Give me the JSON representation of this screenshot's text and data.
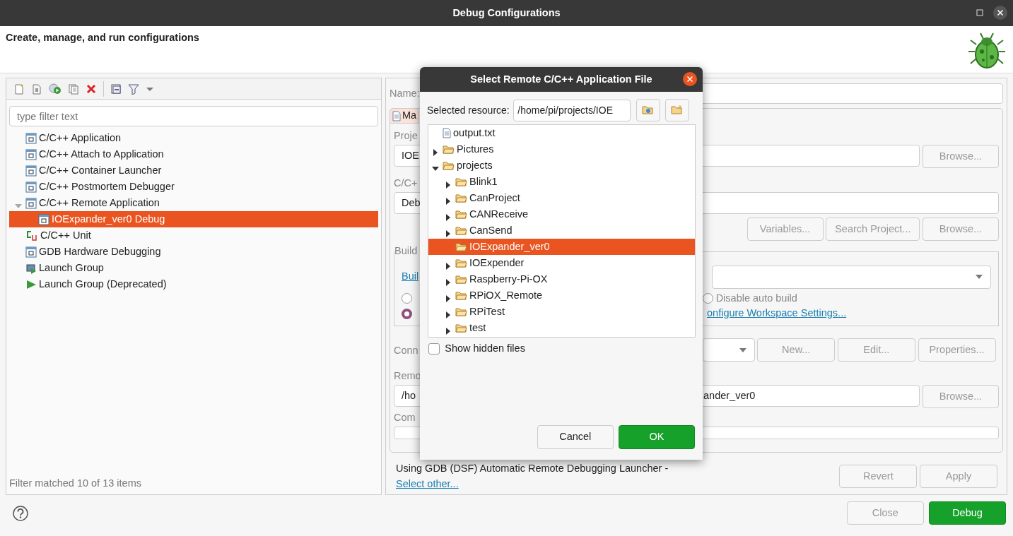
{
  "window": {
    "title": "Debug Configurations"
  },
  "header": {
    "title": "Create, manage, and run configurations"
  },
  "left_panel": {
    "filter": {
      "placeholder": "type filter text"
    },
    "tree": [
      {
        "label": "C/C++ Application",
        "kind": "config",
        "selected": false
      },
      {
        "label": "C/C++ Attach to Application",
        "kind": "config",
        "selected": false
      },
      {
        "label": "C/C++ Container Launcher",
        "kind": "config",
        "selected": false
      },
      {
        "label": "C/C++ Postmortem Debugger",
        "kind": "config",
        "selected": false
      },
      {
        "label": "C/C++ Remote Application",
        "kind": "config",
        "selected": false,
        "expanded": true,
        "children": [
          {
            "label": "IOExpander_ver0 Debug",
            "kind": "config",
            "selected": true
          }
        ]
      },
      {
        "label": "C/C++ Unit",
        "kind": "unit",
        "selected": false
      },
      {
        "label": "GDB Hardware Debugging",
        "kind": "config",
        "selected": false
      },
      {
        "label": "Launch Group",
        "kind": "group",
        "selected": false
      },
      {
        "label": "Launch Group (Deprecated)",
        "kind": "play",
        "selected": false
      }
    ],
    "status": "Filter matched 10 of 13 items"
  },
  "right_panel": {
    "name_label": "Name:",
    "tab": {
      "label": "Ma",
      "selected": true
    },
    "project": {
      "label": "Proje",
      "value": "IOE",
      "button": {
        "label": "Browse...",
        "disabled": true
      }
    },
    "application": {
      "label": "C/C+",
      "value": "Deb"
    },
    "app_buttons": [
      {
        "label": "Variables...",
        "disabled": true
      },
      {
        "label": "Search Project...",
        "disabled": true
      },
      {
        "label": "Browse...",
        "disabled": true
      }
    ],
    "build": {
      "legend": "Build",
      "link": "Buil",
      "radios": [
        {
          "checked": false
        },
        {
          "label": "Disable auto build",
          "checked": false
        },
        {
          "checked": true
        }
      ],
      "settings_link": "onfigure Workspace Settings..."
    },
    "connection": {
      "label": "Conn",
      "buttons": [
        {
          "label": "New...",
          "disabled": true
        },
        {
          "label": "Edit...",
          "disabled": true
        },
        {
          "label": "Properties...",
          "disabled": true
        }
      ]
    },
    "remote": {
      "label": "Remo",
      "value_start": "/ho",
      "value_end": "ander_ver0",
      "button": {
        "label": "Browse...",
        "disabled": true
      }
    },
    "commands": {
      "label": "Com"
    },
    "launcher_text": "Using GDB (DSF) Automatic Remote Debugging Launcher - ",
    "launcher_link": "Select other...",
    "buttons": [
      {
        "label": "Revert",
        "disabled": true
      },
      {
        "label": "Apply",
        "disabled": true
      }
    ]
  },
  "footer": {
    "buttons": [
      {
        "label": "Close",
        "kind": "plain",
        "disabled": true
      },
      {
        "label": "Debug",
        "kind": "primary",
        "disabled": false
      }
    ]
  },
  "dialog": {
    "title": "Select Remote C/C++ Application File",
    "resource_label": "Selected resource:",
    "resource_value": "/home/pi/projects/IOE",
    "tree": [
      {
        "label": "output.txt",
        "kind": "file",
        "selected": false
      },
      {
        "label": "Pictures",
        "kind": "folder",
        "expanded": false,
        "selected": false
      },
      {
        "label": "projects",
        "kind": "folder",
        "expanded": true,
        "selected": false,
        "children": [
          {
            "label": "Blink1",
            "kind": "folder",
            "expanded": false,
            "selected": false
          },
          {
            "label": "CanProject",
            "kind": "folder",
            "expanded": false,
            "selected": false
          },
          {
            "label": "CANReceive",
            "kind": "folder",
            "expanded": false,
            "selected": false
          },
          {
            "label": "CanSend",
            "kind": "folder",
            "expanded": false,
            "selected": false
          },
          {
            "label": "IOExpander_ver0",
            "kind": "folder",
            "selected": true
          },
          {
            "label": "IOExpender",
            "kind": "folder",
            "expanded": false,
            "selected": false
          },
          {
            "label": "Raspberry-Pi-OX",
            "kind": "folder",
            "expanded": false,
            "selected": false
          },
          {
            "label": "RPiOX_Remote",
            "kind": "folder",
            "expanded": false,
            "selected": false
          },
          {
            "label": "RPiTest",
            "kind": "folder",
            "expanded": false,
            "selected": false
          },
          {
            "label": "test",
            "kind": "folder",
            "expanded": false,
            "selected": false
          }
        ]
      }
    ],
    "show_hidden": {
      "label": "Show hidden files",
      "checked": false
    },
    "buttons": [
      {
        "label": "Cancel",
        "kind": "plain"
      },
      {
        "label": "OK",
        "kind": "primary"
      }
    ]
  }
}
